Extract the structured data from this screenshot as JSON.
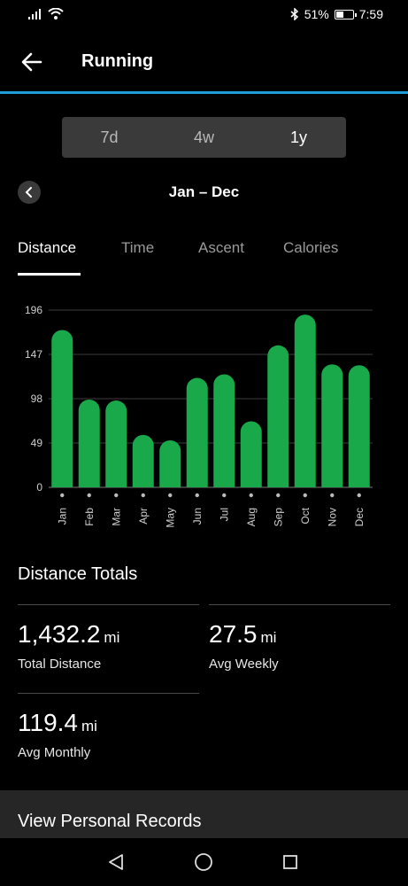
{
  "status": {
    "battery": "51%",
    "battery_level": 0.51,
    "time": "7:59",
    "icons": [
      "signal-icon",
      "wifi-icon",
      "bluetooth-icon",
      "battery-icon"
    ]
  },
  "header": {
    "title": "Running",
    "back_icon": "arrow-left-icon"
  },
  "accent_color": "#1f9ddb",
  "range_selector": {
    "options": [
      "7d",
      "4w",
      "1y"
    ],
    "selected": "1y"
  },
  "date_nav": {
    "range": "Jan – Dec",
    "prev_icon": "chevron-left-icon"
  },
  "metric_tabs": {
    "tabs": [
      "Distance",
      "Time",
      "Ascent",
      "Calories"
    ],
    "selected": "Distance"
  },
  "chart_data": {
    "type": "bar",
    "categories": [
      "Jan",
      "Feb",
      "Mar",
      "Apr",
      "May",
      "Jun",
      "Jul",
      "Aug",
      "Sep",
      "Oct",
      "Nov",
      "Dec"
    ],
    "values": [
      174,
      97,
      96,
      58,
      52,
      121,
      125,
      73,
      157,
      191,
      136,
      135
    ],
    "y_ticks": [
      0,
      49,
      98,
      147,
      196
    ],
    "ylim": [
      0,
      196
    ],
    "bar_color": "#19a84a",
    "grid": true
  },
  "totals": {
    "title": "Distance Totals",
    "stats": [
      {
        "value": "1,432.2",
        "unit": "mi",
        "label": "Total Distance"
      },
      {
        "value": "27.5",
        "unit": "mi",
        "label": "Avg Weekly"
      },
      {
        "value": "119.4",
        "unit": "mi",
        "label": "Avg Monthly"
      }
    ]
  },
  "records": {
    "label": "View Personal Records"
  },
  "nav": {
    "icons": [
      "back-triangle-icon",
      "home-circle-icon",
      "recents-square-icon"
    ]
  }
}
